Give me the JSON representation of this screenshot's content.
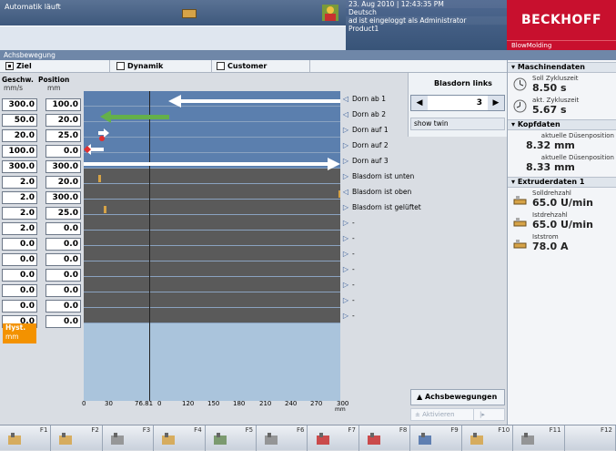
{
  "status": {
    "message": "Automatik läuft",
    "date": "23. Aug 2010",
    "time": "12:43:35 PM",
    "language": "Deutsch",
    "user": "ad ist eingeloggt als Administrator",
    "product": "Product1"
  },
  "brand": {
    "name": "BECKHOFF",
    "app": "BlowMolding"
  },
  "breadcrumb": "Achsbewegung",
  "tabs": [
    {
      "label": "Ziel",
      "checked": true
    },
    {
      "label": "Dynamik",
      "checked": false
    },
    {
      "label": "Customer",
      "checked": false
    }
  ],
  "columns": {
    "speed": "Geschw.",
    "speed_unit": "mm/s",
    "position": "Position",
    "position_unit": "mm"
  },
  "rows": [
    {
      "speed": "300.0",
      "position": "100.0",
      "signal": "Dorn ab 1",
      "arrow": "◁"
    },
    {
      "speed": "50.0",
      "position": "20.0",
      "signal": "Dorn ab 2",
      "arrow": "◁"
    },
    {
      "speed": "20.0",
      "position": "25.0",
      "signal": "Dorn auf 1",
      "arrow": "▷"
    },
    {
      "speed": "100.0",
      "position": "0.0",
      "signal": "Dorn auf 2",
      "arrow": "▷"
    },
    {
      "speed": "300.0",
      "position": "300.0",
      "signal": "Dorn auf 3",
      "arrow": "▷"
    },
    {
      "speed": "2.0",
      "position": "20.0",
      "signal": "Blasdorn ist unten",
      "arrow": "▷"
    },
    {
      "speed": "2.0",
      "position": "300.0",
      "signal": "Blasdorn ist oben",
      "arrow": "◁"
    },
    {
      "speed": "2.0",
      "position": "25.0",
      "signal": "Blasdorn ist gelüftet",
      "arrow": "▷"
    },
    {
      "speed": "2.0",
      "position": "0.0",
      "signal": "-",
      "arrow": "▷"
    },
    {
      "speed": "0.0",
      "position": "0.0",
      "signal": "-",
      "arrow": "▷"
    },
    {
      "speed": "0.0",
      "position": "0.0",
      "signal": "-",
      "arrow": "▷"
    },
    {
      "speed": "0.0",
      "position": "0.0",
      "signal": "-",
      "arrow": "▷"
    },
    {
      "speed": "0.0",
      "position": "0.0",
      "signal": "-",
      "arrow": "▷"
    },
    {
      "speed": "0.0",
      "position": "0.0",
      "signal": "-",
      "arrow": "▷"
    },
    {
      "speed": "0.0",
      "position": "0.0",
      "signal": "-",
      "arrow": "▷"
    }
  ],
  "hyst": {
    "label": "Hyst.",
    "unit": "mm"
  },
  "xaxis": {
    "labels": [
      "0",
      "30",
      "76.81",
      "0",
      "120",
      "150",
      "180",
      "210",
      "240",
      "270",
      "300"
    ],
    "unit": "mm"
  },
  "blasdorn": {
    "title": "Blasdorn links",
    "value": "3",
    "left": "◀",
    "right": "▶",
    "show_twin": "show twin"
  },
  "achs": {
    "label": "Achsbewegungen",
    "aktivieren": "Aktivieren"
  },
  "machine": {
    "title": "Maschinendaten",
    "items": [
      {
        "label": "Soll Zykluszeit",
        "value": "8.50 s"
      },
      {
        "label": "akt. Zykluszeit",
        "value": "5.67 s"
      }
    ],
    "kopf_title": "Kopfdaten",
    "kopf": [
      {
        "label": "aktuelle Düsenposition",
        "value": "8.32 mm"
      },
      {
        "label": "aktuelle Düsenposition",
        "value": "8.33 mm"
      }
    ],
    "extr_title": "Extruderdaten 1",
    "extr": [
      {
        "label": "Solldrehzahl",
        "value": "65.0 U/min"
      },
      {
        "label": "Istdrehzahl",
        "value": "65.0 U/min"
      },
      {
        "label": "Iststrom",
        "value": "78.0 A"
      }
    ]
  },
  "fkeys": [
    "F1",
    "F2",
    "F3",
    "F4",
    "F5",
    "F6",
    "F7",
    "F8",
    "F9",
    "F10",
    "F11",
    "F12"
  ],
  "colors": {
    "brand": "#c8102e",
    "orange": "#f39200",
    "chartLight": "#aac4dc",
    "chartDark": "#5a5a5a",
    "bandBlue": "#5b7fae"
  }
}
